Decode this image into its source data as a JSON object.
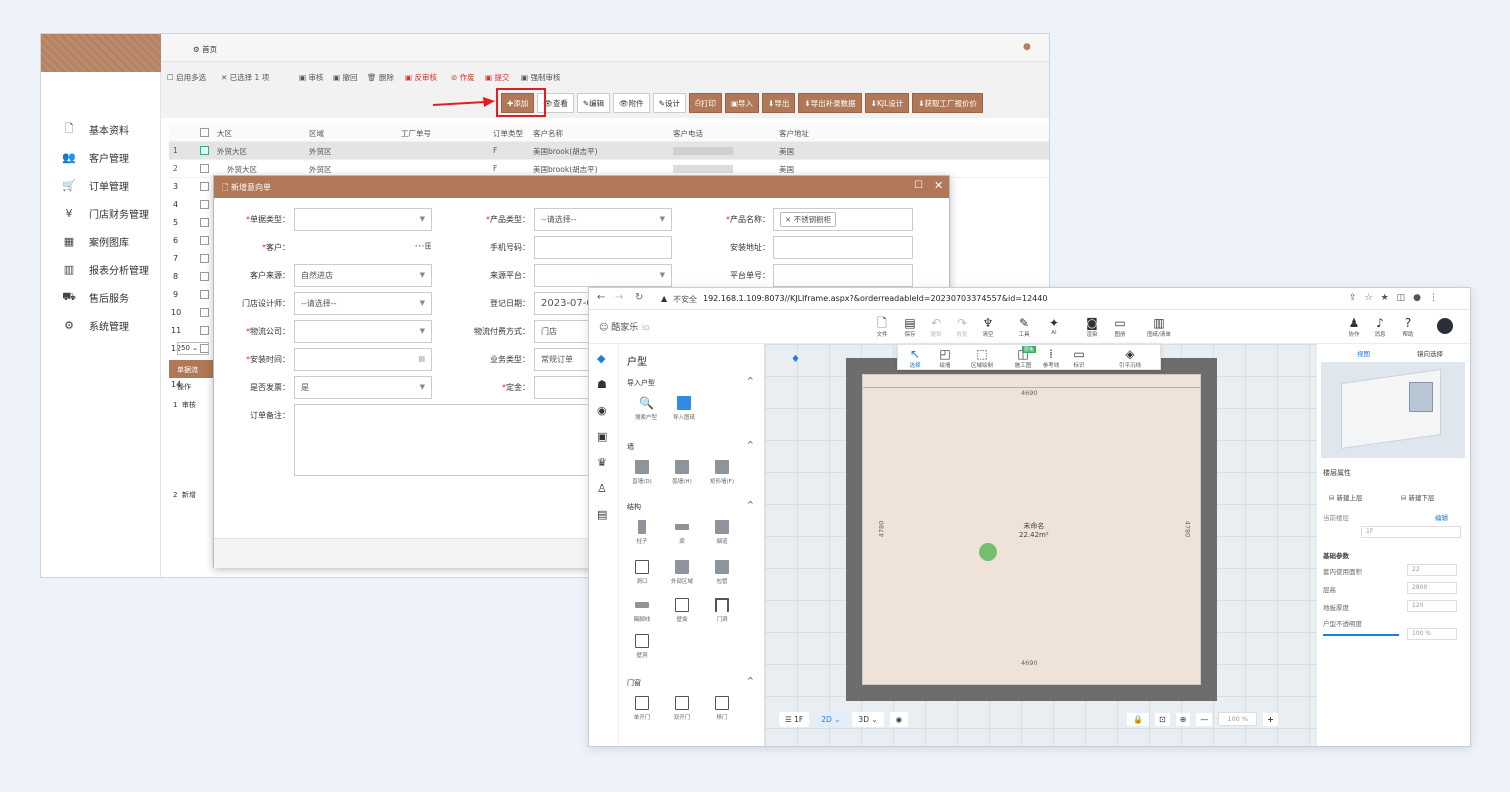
{
  "erp": {
    "topbar": {
      "home": "首页"
    },
    "sidebar": [
      {
        "label": "基本资料",
        "icon": "file-icon"
      },
      {
        "label": "客户管理",
        "icon": "users-icon"
      },
      {
        "label": "订单管理",
        "icon": "cart-icon"
      },
      {
        "label": "门店财务管理",
        "icon": "yen-icon"
      },
      {
        "label": "案例图库",
        "icon": "grid-icon"
      },
      {
        "label": "报表分析管理",
        "icon": "chart-icon"
      },
      {
        "label": "售后服务",
        "icon": "truck-icon"
      },
      {
        "label": "系统管理",
        "icon": "gears-icon"
      }
    ],
    "toolbar_row1": [
      "启用多选",
      "已选择 1 项",
      "审核",
      "撤回",
      "删除",
      "反审核",
      "作废",
      "提交",
      "强制审核"
    ],
    "buttons": [
      "添加",
      "查看",
      "编辑",
      "附件",
      "设计",
      "打印",
      "导入",
      "导出",
      "导出补录数据",
      "KJL设计",
      "获取工厂报价价"
    ],
    "grid": {
      "columns": [
        "大区",
        "区域",
        "工厂单号",
        "订单类型",
        "客户名称",
        "客户电话",
        "客户地址"
      ],
      "rows": [
        {
          "no": "1",
          "region": "外贸大区",
          "area": "外贸区",
          "type": "F",
          "customer": "美国brook(胡志平)",
          "addr": "美国"
        },
        {
          "no": "2",
          "region": "外贸大区",
          "area": "外贸区",
          "type": "F",
          "customer": "美国brook(胡志平)",
          "addr": "美国"
        }
      ],
      "row_numbers": [
        "1",
        "2",
        "3",
        "4",
        "5",
        "6",
        "7",
        "8",
        "9",
        "10",
        "11",
        "12",
        "13",
        "14"
      ],
      "page_size": "50",
      "bottom_tab": "单据流",
      "bottom_col": "操作",
      "bottom_rows": [
        {
          "no": "1",
          "op": "审核"
        },
        {
          "no": "2",
          "op": "新增"
        }
      ]
    },
    "dialog": {
      "title": "新增意向单",
      "fields": {
        "doc_type": "单据类型：",
        "product_type": "产品类型：",
        "product_type_val": "--请选择--",
        "product_name": "产品名称：",
        "product_name_tag": "× 不锈钢橱柜",
        "customer": "客户：",
        "phone": "手机号码：",
        "install_addr": "安装地址：",
        "cust_source": "客户来源：",
        "cust_source_val": "自然进店",
        "source_platform": "来源平台：",
        "platform_no": "平台单号：",
        "designer": "门店设计师：",
        "designer_val": "--请选择--",
        "reg_date": "登记日期：",
        "reg_date_val": "2023-07-0",
        "logistics": "物流公司：",
        "pay_method": "物流付费方式：",
        "pay_method_val": "门店",
        "install_time": "安装时间：",
        "biz_type": "业务类型：",
        "biz_type_val": "常规订单",
        "invoice": "是否发票：",
        "invoice_val": "是",
        "deposit": "定金：",
        "remark": "订单备注："
      }
    }
  },
  "browser": {
    "security": "不安全",
    "url": "192.168.1.109:8073//KJLIframe.aspx?&orderreadableId=20230703374557&id=12440",
    "logo": "酷家乐",
    "logo_tag": "3D",
    "top_tools": [
      "文件",
      "保存",
      "撤销",
      "恢复",
      "清空",
      "工具",
      "AI",
      "渲染",
      "图册",
      "图纸/清单"
    ],
    "right_tools": [
      "协作",
      "消息",
      "帮助"
    ],
    "sub_tools": [
      "选择",
      "绘墙",
      "区域绘制",
      "施工图",
      "参考线",
      "标识",
      "引平沉线"
    ],
    "sub_badge": "限免",
    "panel_title": "户型",
    "sections": {
      "import": "导入户型",
      "wall": "墙",
      "struct": "结构",
      "door": "门窗"
    },
    "import_items": [
      "搜索户型",
      "导入图纸"
    ],
    "wall_items": [
      "直墙(D)",
      "弧墙(H)",
      "矩形墙(F)"
    ],
    "struct_items": [
      "柱子",
      "梁",
      "烟道",
      "洞口",
      "外部区域",
      "包管",
      "踢脚线",
      "壁龛",
      "门洞",
      "壁洞"
    ],
    "door_items": [
      "单开门",
      "双开门",
      "移门"
    ],
    "room": {
      "top": "4690",
      "bottom": "4690",
      "left": "4780",
      "right": "4780",
      "name": "未命名",
      "area": "22.42m²"
    },
    "bottom_bar": {
      "floor": "1F",
      "mode2d": "2D",
      "mode3d": "3D",
      "zoom": "100",
      "unit": "%"
    },
    "right_panel": {
      "tabs": [
        "视图",
        "镜向选择"
      ],
      "floor_title": "楼层属性",
      "new_up": "新建上层",
      "new_down": "新建下层",
      "cur_floor": "当前楼层",
      "cur_floor_val": "1F",
      "edit": "编辑",
      "basic": "基础参数",
      "inner_area": "套内使用面积",
      "inner_area_val": "22",
      "height": "层高",
      "height_val": "2800",
      "thick": "地板厚度",
      "thick_val": "120",
      "opacity": "户型不透明度",
      "opacity_val": "100"
    }
  }
}
